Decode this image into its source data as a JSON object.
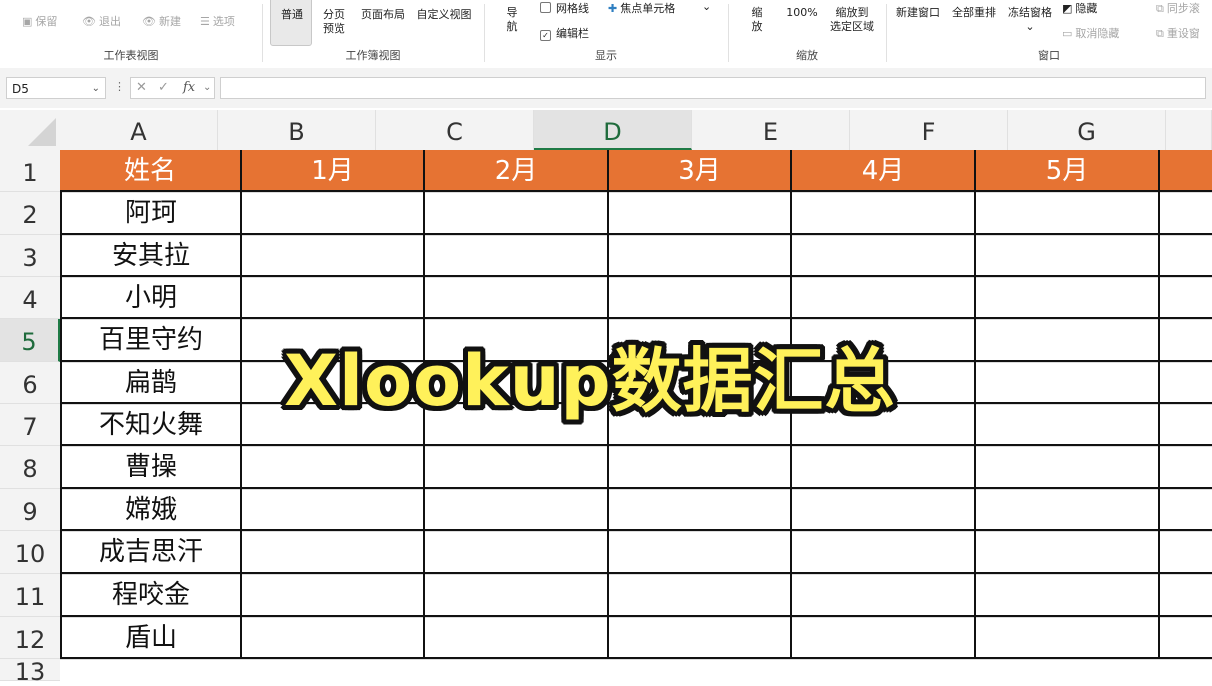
{
  "ribbon": {
    "workbook_views": {
      "title": "工作表视图",
      "keep": "保留",
      "exit": "退出",
      "new": "新建",
      "options": "选项"
    },
    "book_views": {
      "title": "工作簿视图",
      "normal": "普通",
      "page_break_1": "分页",
      "page_break_2": "预览",
      "page_layout": "页面布局",
      "custom_view": "自定义视图"
    },
    "show": {
      "title": "显示",
      "nav_1": "导",
      "nav_2": "航",
      "gridlines": "网格线",
      "focus_cell": "焦点单元格",
      "formula_bar": "编辑栏"
    },
    "zoom": {
      "title": "缩放",
      "zoom_1": "缩",
      "zoom_2": "放",
      "hundred": "100%",
      "to_selection_1": "缩放到",
      "to_selection_2": "选定区域"
    },
    "window": {
      "title": "窗口",
      "new_window": "新建窗口",
      "arrange_all": "全部重排",
      "freeze_panes": "冻结窗格",
      "hide": "隐藏",
      "unhide": "取消隐藏",
      "sync_scroll": "同步滚",
      "reset_pos": "重设窗"
    }
  },
  "formula_bar": {
    "name_box": "D5",
    "cancel": "✕",
    "enter": "✓",
    "fx": "fx",
    "value": ""
  },
  "columns": [
    "A",
    "B",
    "C",
    "D",
    "E",
    "F",
    "G"
  ],
  "rows": [
    "1",
    "2",
    "3",
    "4",
    "5",
    "6",
    "7",
    "8",
    "9",
    "10",
    "11",
    "12",
    "13"
  ],
  "active_cell": {
    "column": "D",
    "row": "5"
  },
  "table": {
    "header": [
      "姓名",
      "1月",
      "2月",
      "3月",
      "4月",
      "5月"
    ],
    "names": [
      "阿珂",
      "安其拉",
      "小明",
      "百里守约",
      "扁鹊",
      "不知火舞",
      "曹操",
      "嫦娥",
      "成吉思汗",
      "程咬金",
      "盾山"
    ]
  },
  "overlay_title": "Xlookup数据汇总",
  "colors": {
    "header_fill": "#e67333",
    "header_text": "#ffffff",
    "overlay_text": "#fff15a",
    "overlay_outline": "#111111",
    "active_accent": "#1f7a45"
  }
}
